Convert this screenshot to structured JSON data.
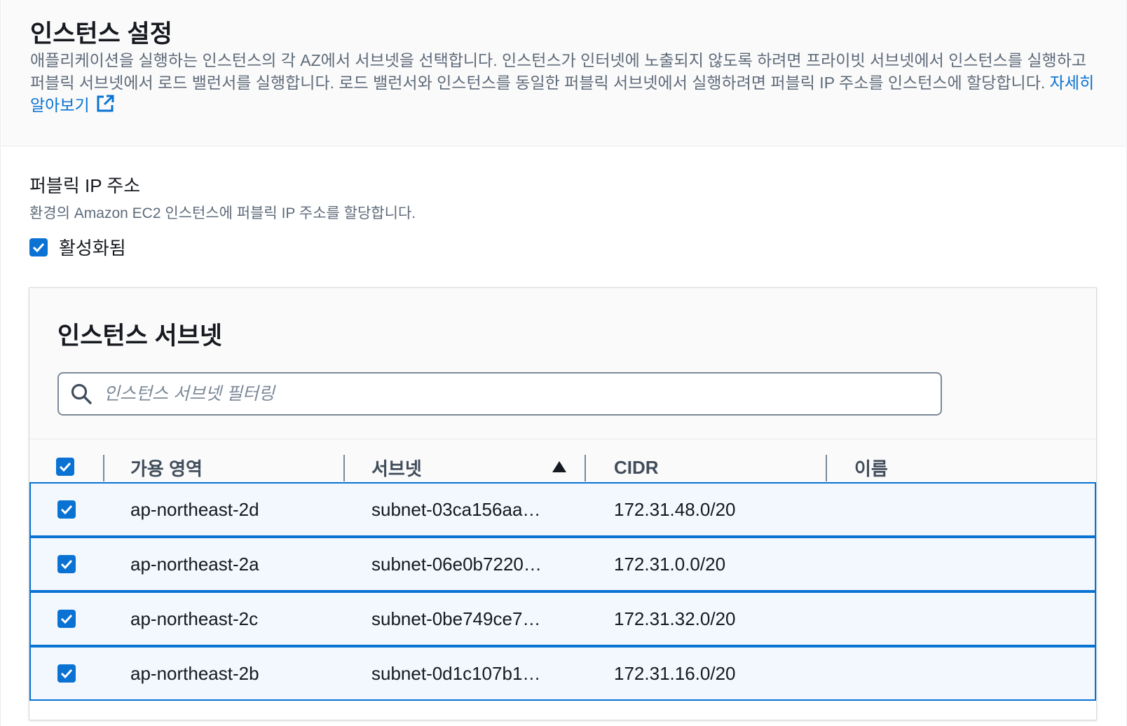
{
  "header": {
    "title": "인스턴스 설정",
    "description": "애플리케이션을 실행하는 인스턴스의 각 AZ에서 서브넷을 선택합니다. 인스턴스가 인터넷에 노출되지 않도록 하려면 프라이빗 서브넷에서 인스턴스를 실행하고 퍼블릭 서브넷에서 로드 밸런서를 실행합니다. 로드 밸런서와 인스턴스를 동일한 퍼블릭 서브넷에서 실행하려면 퍼블릭 IP 주소를 인스턴스에 할당합니다.",
    "learn_more_link": "자세히 알아보기"
  },
  "public_ip": {
    "label": "퍼블릭 IP 주소",
    "description": "환경의 Amazon EC2 인스턴스에 퍼블릭 IP 주소를 할당합니다.",
    "checkbox_label": "활성화됨",
    "checked": true
  },
  "subnets": {
    "title": "인스턴스 서브넷",
    "filter_placeholder": "인스턴스 서브넷 필터링",
    "columns": {
      "az": "가용 영역",
      "subnet": "서브넷",
      "cidr": "CIDR",
      "name": "이름"
    },
    "rows": [
      {
        "az": "ap-northeast-2d",
        "subnet": "subnet-03ca156aa…",
        "cidr": "172.31.48.0/20",
        "name": ""
      },
      {
        "az": "ap-northeast-2a",
        "subnet": "subnet-06e0b7220…",
        "cidr": "172.31.0.0/20",
        "name": ""
      },
      {
        "az": "ap-northeast-2c",
        "subnet": "subnet-0be749ce7…",
        "cidr": "172.31.32.0/20",
        "name": ""
      },
      {
        "az": "ap-northeast-2b",
        "subnet": "subnet-0d1c107b1…",
        "cidr": "172.31.16.0/20",
        "name": ""
      }
    ]
  },
  "colors": {
    "accent": "#0972d3",
    "row_selected_bg": "#f2f8fd",
    "header_bg": "#fafafa"
  }
}
